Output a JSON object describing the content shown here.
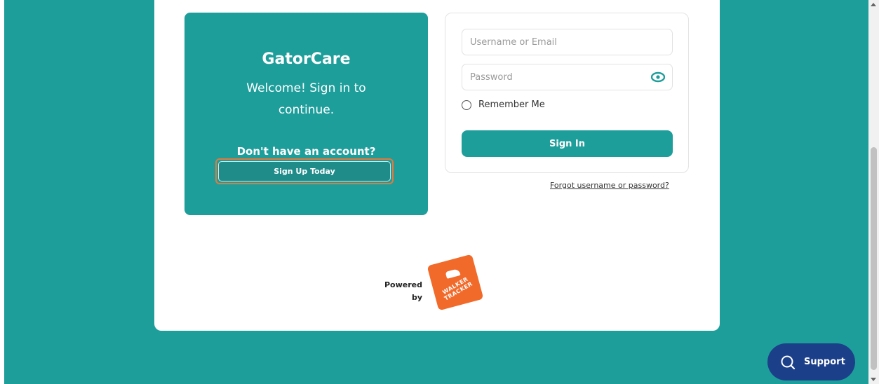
{
  "welcome": {
    "app_title": "GatorCare",
    "subtitle": "Welcome! Sign in to continue.",
    "prompt": "Don't have an account?",
    "signup_label": "Sign Up Today"
  },
  "login": {
    "username_placeholder": "Username or Email",
    "password_placeholder": "Password",
    "remember_label": "Remember Me",
    "signin_label": "Sign In",
    "forgot_link": "Forgot username or password?"
  },
  "footer": {
    "powered_line1": "Powered",
    "powered_line2": "by",
    "logo_text": "WALKER TRACKER"
  },
  "support": {
    "label": "Support"
  },
  "colors": {
    "brand": "#1e9e9b",
    "accent": "#f26a2a",
    "support": "#1c3f8a",
    "highlight": "#e07a3e"
  },
  "icons": {
    "eye": "eye-icon",
    "search": "search-icon"
  }
}
